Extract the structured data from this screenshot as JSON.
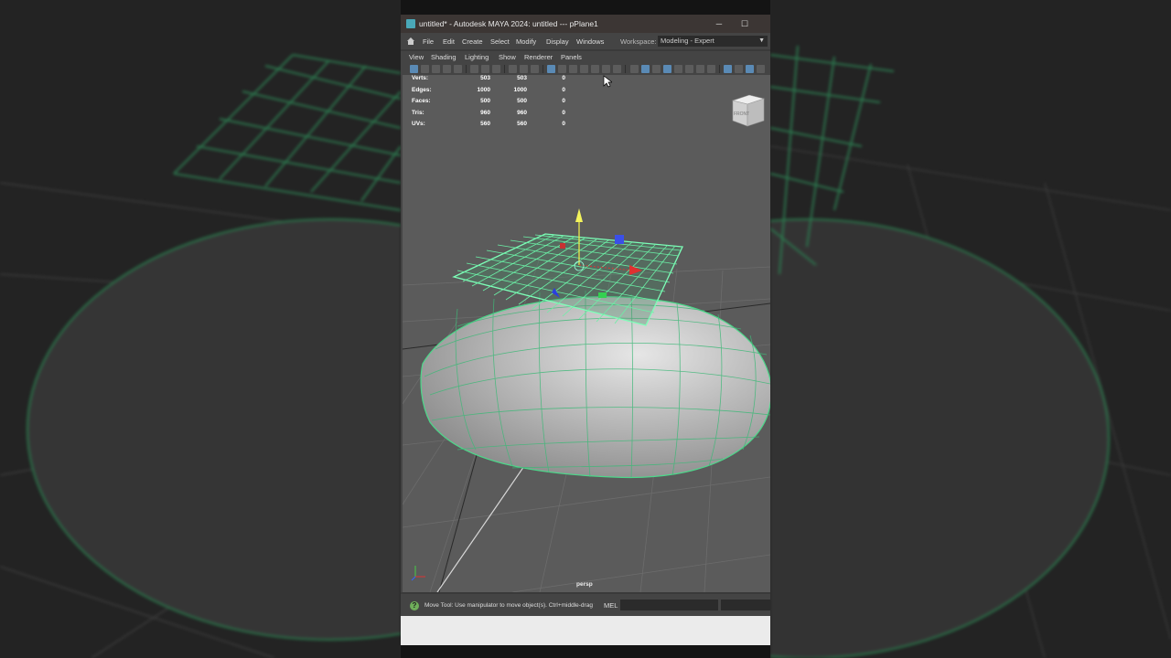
{
  "window": {
    "title": "untitled* - Autodesk MAYA 2024: untitled   ---   pPlane1",
    "minimize_glyph": "─",
    "maximize_glyph": "☐",
    "app_icon": "maya-icon"
  },
  "menubar": {
    "items": [
      "File",
      "Edit",
      "Create",
      "Select",
      "Modify",
      "Display",
      "Windows"
    ],
    "workspace_label": "Workspace:",
    "workspace_value": "Modeling - Expert"
  },
  "panel_menu": {
    "items": [
      "View",
      "Shading",
      "Lighting",
      "Show",
      "Renderer",
      "Panels"
    ]
  },
  "hud": {
    "rows": [
      {
        "label": "Verts:",
        "values": [
          "503",
          "503",
          "0"
        ]
      },
      {
        "label": "Edges:",
        "values": [
          "1000",
          "1000",
          "0"
        ]
      },
      {
        "label": "Faces:",
        "values": [
          "500",
          "500",
          "0"
        ]
      },
      {
        "label": "Tris:",
        "values": [
          "960",
          "960",
          "0"
        ]
      },
      {
        "label": "UVs:",
        "values": [
          "560",
          "560",
          "0"
        ]
      }
    ]
  },
  "viewport": {
    "camera": "persp",
    "viewcube_face": "FRONT",
    "wireframe_color": "#5df0a0",
    "selected_object": "pPlane1"
  },
  "status": {
    "help_glyph": "?",
    "message": "Move Tool: Use manipulator to move object(s). Ctrl+middle-drag t",
    "command_language": "MEL"
  }
}
